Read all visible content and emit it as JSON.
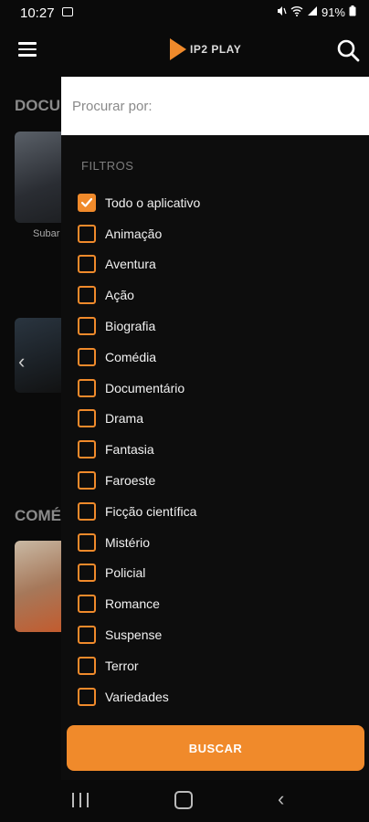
{
  "status_bar": {
    "time": "10:27",
    "battery": "91%"
  },
  "app_bar": {
    "logo_text": "IP2 PLAY"
  },
  "background": {
    "section1_title": "DOCU",
    "section1_caption": "Subar",
    "section2_title": "COMÉ"
  },
  "drawer": {
    "search": {
      "placeholder": "Procurar por:",
      "value": ""
    },
    "filters_title": "FILTROS",
    "filters": [
      {
        "label": "Todo o aplicativo",
        "checked": true
      },
      {
        "label": "Animação",
        "checked": false
      },
      {
        "label": "Aventura",
        "checked": false
      },
      {
        "label": "Ação",
        "checked": false
      },
      {
        "label": "Biografia",
        "checked": false
      },
      {
        "label": "Comédia",
        "checked": false
      },
      {
        "label": "Documentário",
        "checked": false
      },
      {
        "label": "Drama",
        "checked": false
      },
      {
        "label": "Fantasia",
        "checked": false
      },
      {
        "label": "Faroeste",
        "checked": false
      },
      {
        "label": "Ficção científica",
        "checked": false
      },
      {
        "label": "Mistério",
        "checked": false
      },
      {
        "label": "Policial",
        "checked": false
      },
      {
        "label": "Romance",
        "checked": false
      },
      {
        "label": "Suspense",
        "checked": false
      },
      {
        "label": "Terror",
        "checked": false
      },
      {
        "label": "Variedades",
        "checked": false
      }
    ],
    "submit_label": "BUSCAR"
  },
  "colors": {
    "accent": "#f08a2b",
    "background": "#0a0a0a",
    "drawer_background": "#0d0d0d"
  },
  "icons": {
    "menu": "hamburger-icon",
    "search": "search-icon",
    "checkbox": "checkmark-icon"
  }
}
